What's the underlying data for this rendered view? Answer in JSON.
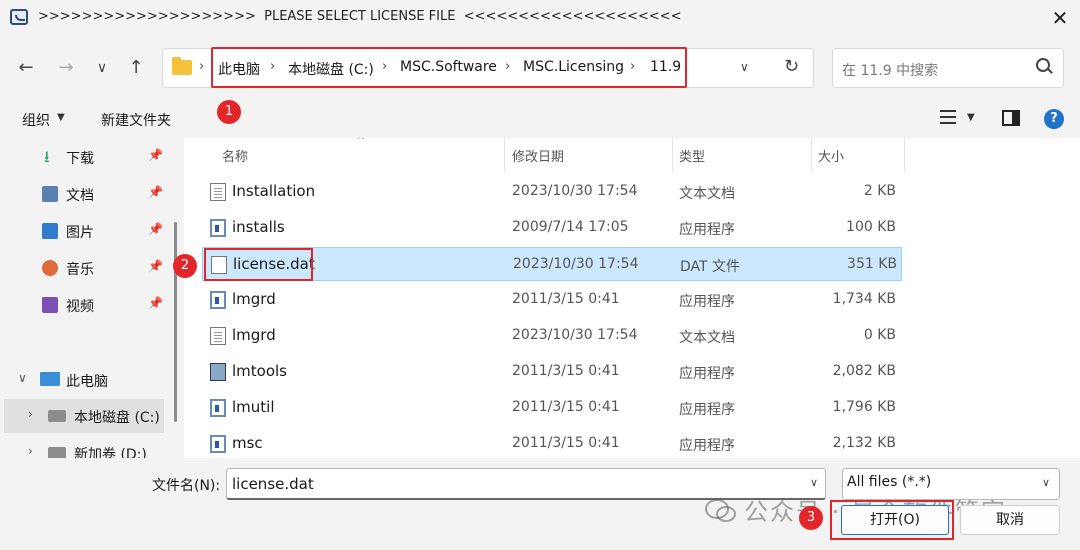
{
  "window": {
    "title": ">>>>>>>>>>>>>>>>>>>>  PLEASE SELECT LICENSE FILE  <<<<<<<<<<<<<<<<<<<<",
    "close_glyph": "✕"
  },
  "nav": {
    "back": "←",
    "forward": "→",
    "recent": "∨",
    "up": "↑",
    "breadcrumb": [
      "此电脑",
      "本地磁盘 (C:)",
      "MSC.Software",
      "MSC.Licensing",
      "11.9"
    ],
    "separator": "›",
    "dropdown": "∨",
    "refresh": "↻",
    "search_placeholder": "在 11.9 中搜索"
  },
  "toolbar": {
    "organize": "组织",
    "new_folder": "新建文件夹",
    "caret": "▼",
    "help": "?"
  },
  "badges": [
    "1",
    "2",
    "3"
  ],
  "sidebar": {
    "pin": "📌",
    "quick_items": [
      {
        "label": "下载",
        "icon": "download-icon",
        "color": "#2a9d5a"
      },
      {
        "label": "文档",
        "icon": "document-icon",
        "color": "#5a7fb3"
      },
      {
        "label": "图片",
        "icon": "picture-icon",
        "color": "#2f7ccf"
      },
      {
        "label": "音乐",
        "icon": "music-icon",
        "color": "#e06a3b"
      },
      {
        "label": "视频",
        "icon": "video-icon",
        "color": "#7b4fb8"
      }
    ],
    "this_pc": "此电脑",
    "drives": [
      "本地磁盘 (C:)",
      "新加卷 (D:)"
    ],
    "expand_open": "∨",
    "expand_closed": "›"
  },
  "columns": {
    "name": "名称",
    "modified": "修改日期",
    "type": "类型",
    "size": "大小",
    "sort": "^"
  },
  "files": [
    {
      "name": "Installation",
      "date": "2023/10/30 17:54",
      "type": "文本文档",
      "size": "2 KB",
      "icon": "txt"
    },
    {
      "name": "installs",
      "date": "2009/7/14 17:05",
      "type": "应用程序",
      "size": "100 KB",
      "icon": "exe"
    },
    {
      "name": "license.dat",
      "date": "2023/10/30 17:54",
      "type": "DAT 文件",
      "size": "351 KB",
      "icon": "dat"
    },
    {
      "name": "lmgrd",
      "date": "2011/3/15 0:41",
      "type": "应用程序",
      "size": "1,734 KB",
      "icon": "exe"
    },
    {
      "name": "lmgrd",
      "date": "2023/10/30 17:54",
      "type": "文本文档",
      "size": "0 KB",
      "icon": "txt"
    },
    {
      "name": "lmtools",
      "date": "2011/3/15 0:41",
      "type": "应用程序",
      "size": "2,082 KB",
      "icon": "tool"
    },
    {
      "name": "lmutil",
      "date": "2011/3/15 0:41",
      "type": "应用程序",
      "size": "1,796 KB",
      "icon": "exe"
    },
    {
      "name": "msc",
      "date": "2011/3/15 0:41",
      "type": "应用程序",
      "size": "2,132 KB",
      "icon": "exe"
    }
  ],
  "selected_index": 2,
  "footer": {
    "filename_label": "文件名(N):",
    "filename_value": "license.dat",
    "filter_value": "All files (*.*)",
    "caret": "∨",
    "open": "打开(O)",
    "cancel": "取消"
  },
  "watermark": "公众号 · 最全软件管家"
}
